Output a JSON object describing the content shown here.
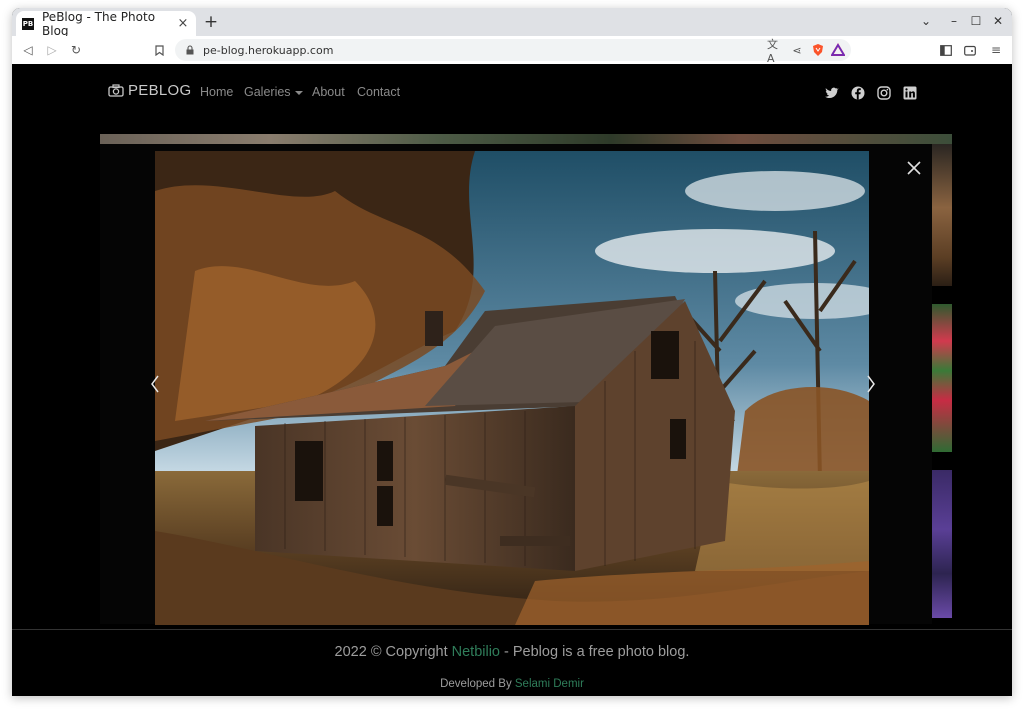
{
  "browser": {
    "tab_title": "PeBlog - The Photo Blog",
    "favicon_text": "PB",
    "url": "pe-blog.herokuapp.com",
    "new_tab": "+",
    "tab_close": "×"
  },
  "site": {
    "brand": "PEBLOG",
    "nav": {
      "home": "Home",
      "galeries": "Galeries",
      "about": "About",
      "contact": "Contact"
    },
    "social_icons": [
      "twitter-icon",
      "facebook-icon",
      "instagram-icon",
      "linkedin-icon"
    ]
  },
  "lightbox": {
    "image_subject": "weathered wooden barn among autumn trees"
  },
  "footer": {
    "copyright_prefix": "2022 © Copyright ",
    "copyright_link": "Netbilio",
    "copyright_suffix": " - Peblog is a free photo blog.",
    "developed_prefix": "Developed By ",
    "developer": "Selami Demir"
  },
  "colors": {
    "accent_link": "#2f7d5a",
    "nav_text": "#8a8a8a",
    "background": "#000000"
  }
}
